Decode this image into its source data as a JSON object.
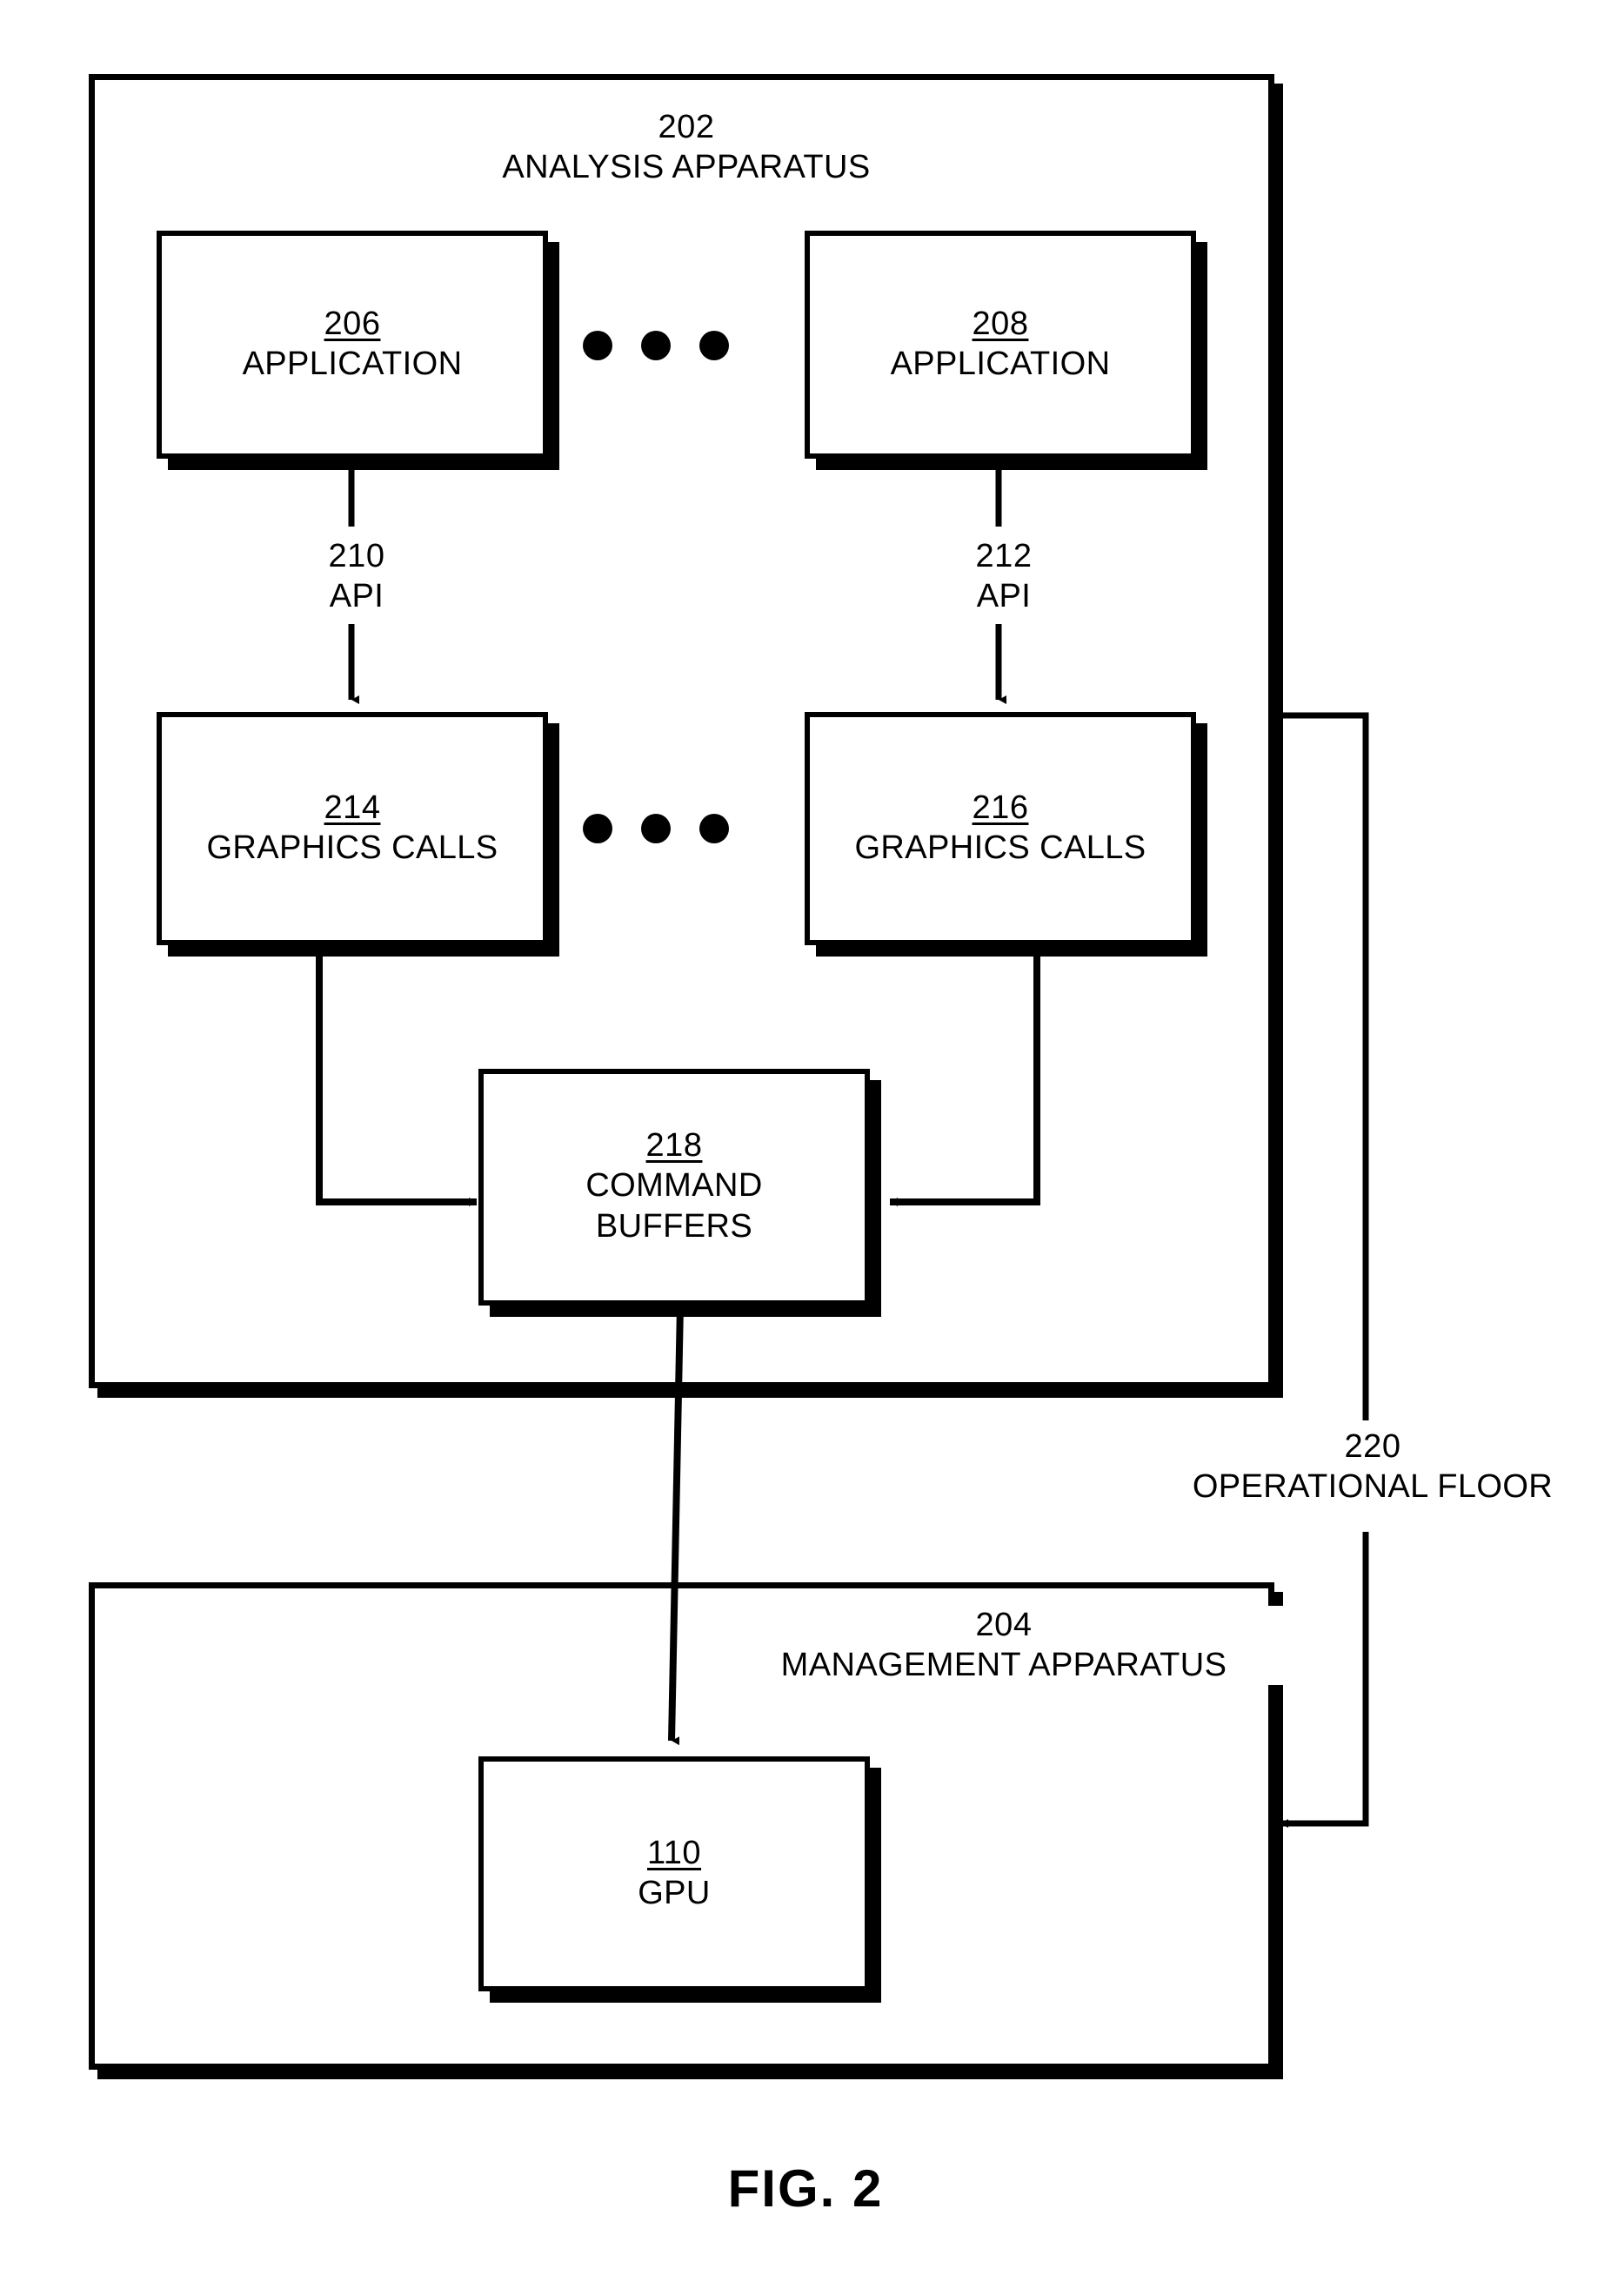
{
  "figure": {
    "caption": "FIG. 2"
  },
  "containers": [
    {
      "id": "analysis-apparatus",
      "ref": "202",
      "label": "ANALYSIS APPARATUS"
    },
    {
      "id": "management-apparatus",
      "ref": "204",
      "label": "MANAGEMENT APPARATUS"
    }
  ],
  "nodes": [
    {
      "id": "application-left",
      "ref": "206",
      "label": "APPLICATION"
    },
    {
      "id": "application-right",
      "ref": "208",
      "label": "APPLICATION"
    },
    {
      "id": "graphics-calls-left",
      "ref": "214",
      "label": "GRAPHICS CALLS"
    },
    {
      "id": "graphics-calls-right",
      "ref": "216",
      "label": "GRAPHICS CALLS"
    },
    {
      "id": "command-buffers",
      "ref": "218",
      "label_line1": "COMMAND",
      "label_line2": "BUFFERS"
    },
    {
      "id": "gpu",
      "ref": "110",
      "label": "GPU"
    }
  ],
  "connector_labels": [
    {
      "id": "api-left",
      "ref": "210",
      "label": "API"
    },
    {
      "id": "api-right",
      "ref": "212",
      "label": "API"
    },
    {
      "id": "operational-floor",
      "ref": "220",
      "label": "OPERATIONAL FLOOR"
    }
  ],
  "ellipsis": {
    "dot_count": 3
  },
  "colors": {
    "stroke": "#000000",
    "fill": "#ffffff"
  }
}
